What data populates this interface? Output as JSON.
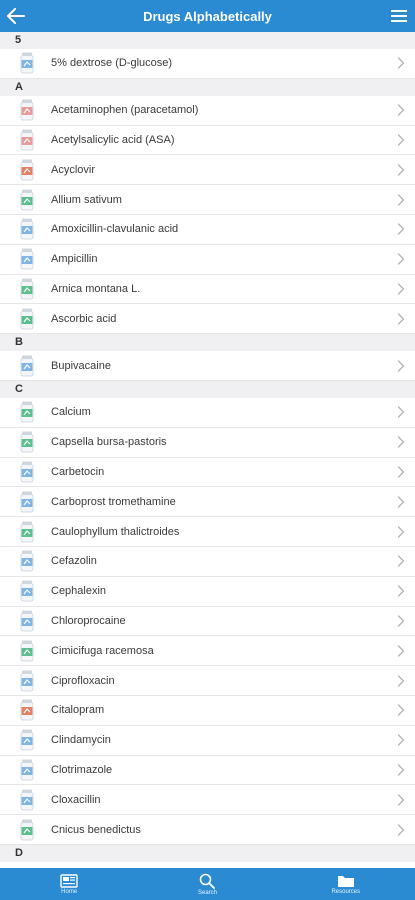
{
  "header": {
    "title": "Drugs Alphabetically"
  },
  "colors": {
    "accent": "#2a8ad2",
    "pill_blue": "#6aa8e0",
    "pill_green": "#3fb57a",
    "pill_pink": "#e88a8a",
    "pill_red": "#e26a4a"
  },
  "sections": [
    {
      "letter": "5",
      "items": [
        {
          "label": "5% dextrose (D-glucose)",
          "icon": "blue"
        }
      ]
    },
    {
      "letter": "A",
      "items": [
        {
          "label": "Acetaminophen (paracetamol)",
          "icon": "pink"
        },
        {
          "label": "Acetylsalicylic acid (ASA)",
          "icon": "pink"
        },
        {
          "label": "Acyclovir",
          "icon": "red"
        },
        {
          "label": "Allium sativum",
          "icon": "green"
        },
        {
          "label": "Amoxicillin-clavulanic acid",
          "icon": "blue"
        },
        {
          "label": "Ampicillin",
          "icon": "blue"
        },
        {
          "label": "Arnica montana L.",
          "icon": "green"
        },
        {
          "label": "Ascorbic acid",
          "icon": "green"
        }
      ]
    },
    {
      "letter": "B",
      "items": [
        {
          "label": "Bupivacaine",
          "icon": "blue"
        }
      ]
    },
    {
      "letter": "C",
      "items": [
        {
          "label": "Calcium",
          "icon": "green"
        },
        {
          "label": "Capsella bursa-pastoris",
          "icon": "green"
        },
        {
          "label": "Carbetocin",
          "icon": "blue"
        },
        {
          "label": "Carboprost tromethamine",
          "icon": "blue"
        },
        {
          "label": "Caulophyllum thalictroides",
          "icon": "green"
        },
        {
          "label": "Cefazolin",
          "icon": "blue"
        },
        {
          "label": "Cephalexin",
          "icon": "blue"
        },
        {
          "label": "Chloroprocaine",
          "icon": "blue"
        },
        {
          "label": "Cimicifuga racemosa",
          "icon": "green"
        },
        {
          "label": "Ciprofloxacin",
          "icon": "blue"
        },
        {
          "label": "Citalopram",
          "icon": "red"
        },
        {
          "label": "Clindamycin",
          "icon": "blue"
        },
        {
          "label": "Clotrimazole",
          "icon": "blue"
        },
        {
          "label": "Cloxacillin",
          "icon": "blue"
        },
        {
          "label": "Cnicus benedictus",
          "icon": "green"
        }
      ]
    },
    {
      "letter": "D",
      "items": []
    }
  ],
  "tabs": [
    {
      "label": "Home",
      "icon": "home-icon"
    },
    {
      "label": "Search",
      "icon": "search-icon"
    },
    {
      "label": "Resources",
      "icon": "folder-icon"
    }
  ]
}
